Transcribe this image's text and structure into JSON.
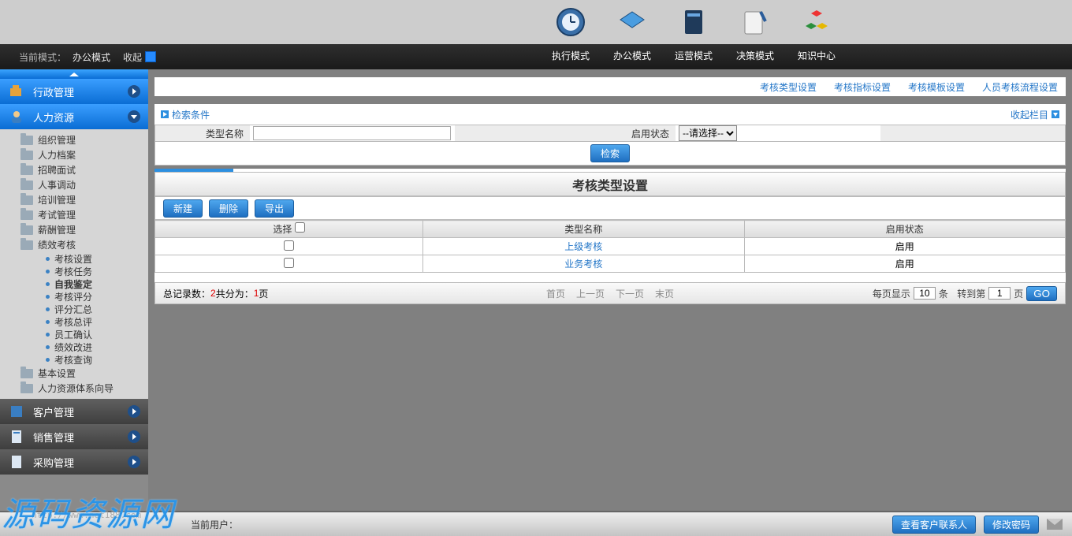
{
  "blackStrip": {
    "modeLabel": "当前模式：",
    "modeVal": "办公模式",
    "collapse": "收起"
  },
  "topNav": [
    {
      "label": "执行模式"
    },
    {
      "label": "办公模式"
    },
    {
      "label": "运营模式"
    },
    {
      "label": "决策模式"
    },
    {
      "label": "知识中心"
    }
  ],
  "sidebar": {
    "sections": {
      "admin": "行政管理",
      "hr": "人力资源",
      "customer": "客户管理",
      "sales": "销售管理",
      "purchase": "采购管理"
    },
    "hrTree": [
      "组织管理",
      "人力档案",
      "招聘面试",
      "人事调动",
      "培训管理",
      "考试管理",
      "薪酬管理",
      "绩效考核",
      "基本设置",
      "人力资源体系向导"
    ],
    "perfSub": [
      "考核设置",
      "考核任务",
      "自我鉴定",
      "考核评分",
      "评分汇总",
      "考核总评",
      "员工确认",
      "绩效改进",
      "考核查询"
    ]
  },
  "topLinks": [
    "考核类型设置",
    "考核指标设置",
    "考核模板设置",
    "人员考核流程设置"
  ],
  "searchPanel": {
    "header": "检索条件",
    "collapseTxt": "收起栏目",
    "typeNameLabel": "类型名称",
    "statusLabel": "启用状态",
    "statusPlaceholder": "--请选择--",
    "searchBtn": "检索"
  },
  "listTitle": "考核类型设置",
  "toolbar": {
    "new": "新建",
    "delete": "删除",
    "export": "导出"
  },
  "gridHeaders": {
    "select": "选择",
    "typeName": "类型名称",
    "status": "启用状态"
  },
  "gridRows": [
    {
      "name": "上级考核",
      "status": "启用"
    },
    {
      "name": "业务考核",
      "status": "启用"
    }
  ],
  "pager": {
    "totalLabel": "总记录数：",
    "total": "2",
    "pagesLabel": " 共分为：",
    "pages": "1",
    "pagesUnit": "页",
    "first": "首页",
    "prev": "上一页",
    "next": "下一页",
    "last": "末页",
    "perPageLabel": "每页显示",
    "perPage": "10",
    "perPageUnit": "条",
    "gotoLabel": "转到第",
    "gotoVal": "1",
    "gotoUnit": "页",
    "go": "GO"
  },
  "bottom": {
    "userLabel": "当前用户：",
    "viewContact": "查看客户联系人",
    "changePwd": "修改密码"
  },
  "watermark": {
    "text": "源码资源网",
    "url": "http://www.net188.com"
  }
}
